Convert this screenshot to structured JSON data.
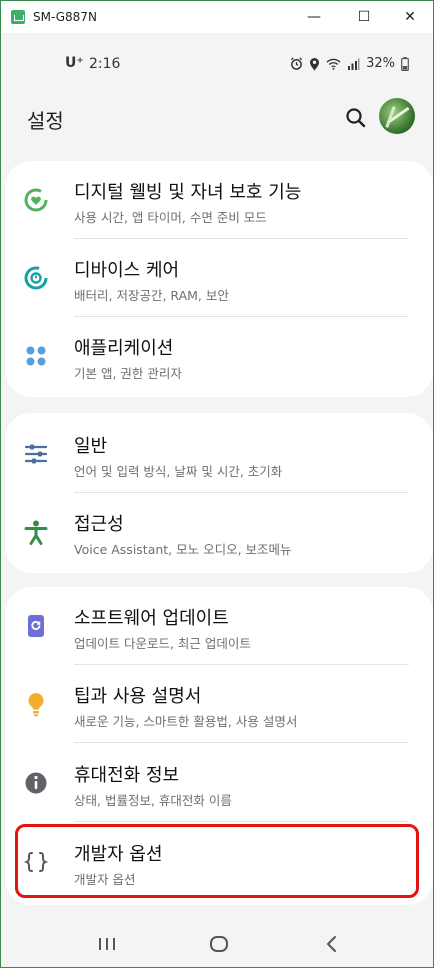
{
  "window": {
    "title": "SM-G887N",
    "minimize": "—",
    "maximize": "☐",
    "close": "✕"
  },
  "statusbar": {
    "carrier": "U⁺",
    "time": "2:16",
    "battery": "32%"
  },
  "header": {
    "title": "설정"
  },
  "cards": [
    {
      "items": [
        {
          "label": "디지털 웰빙 및 자녀 보호 기능",
          "sub": "사용 시간, 앱 타이머, 수면 준비 모드",
          "icon": "digital-wellbeing-icon"
        },
        {
          "label": "디바이스 케어",
          "sub": "배터리, 저장공간, RAM, 보안",
          "icon": "device-care-icon"
        },
        {
          "label": "애플리케이션",
          "sub": "기본 앱, 권한 관리자",
          "icon": "apps-grid-icon"
        }
      ]
    },
    {
      "items": [
        {
          "label": "일반",
          "sub": "언어 및 입력 방식, 날짜 및 시간, 초기화",
          "icon": "sliders-icon"
        },
        {
          "label": "접근성",
          "sub": "Voice Assistant, 모노 오디오, 보조메뉴",
          "icon": "accessibility-icon"
        }
      ]
    },
    {
      "items": [
        {
          "label": "소프트웨어 업데이트",
          "sub": "업데이트 다운로드, 최근 업데이트",
          "icon": "software-update-icon"
        },
        {
          "label": "팁과 사용 설명서",
          "sub": "새로운 기능, 스마트한 활용법, 사용 설명서",
          "icon": "lightbulb-icon"
        },
        {
          "label": "휴대전화 정보",
          "sub": "상태, 법률정보, 휴대전화 이름",
          "icon": "info-icon"
        },
        {
          "label": "개발자 옵션",
          "sub": "개발자 옵션",
          "icon": "braces-icon"
        }
      ]
    }
  ],
  "colors": {
    "accent_green": "#3fae6a",
    "highlight_red": "#e21515"
  }
}
